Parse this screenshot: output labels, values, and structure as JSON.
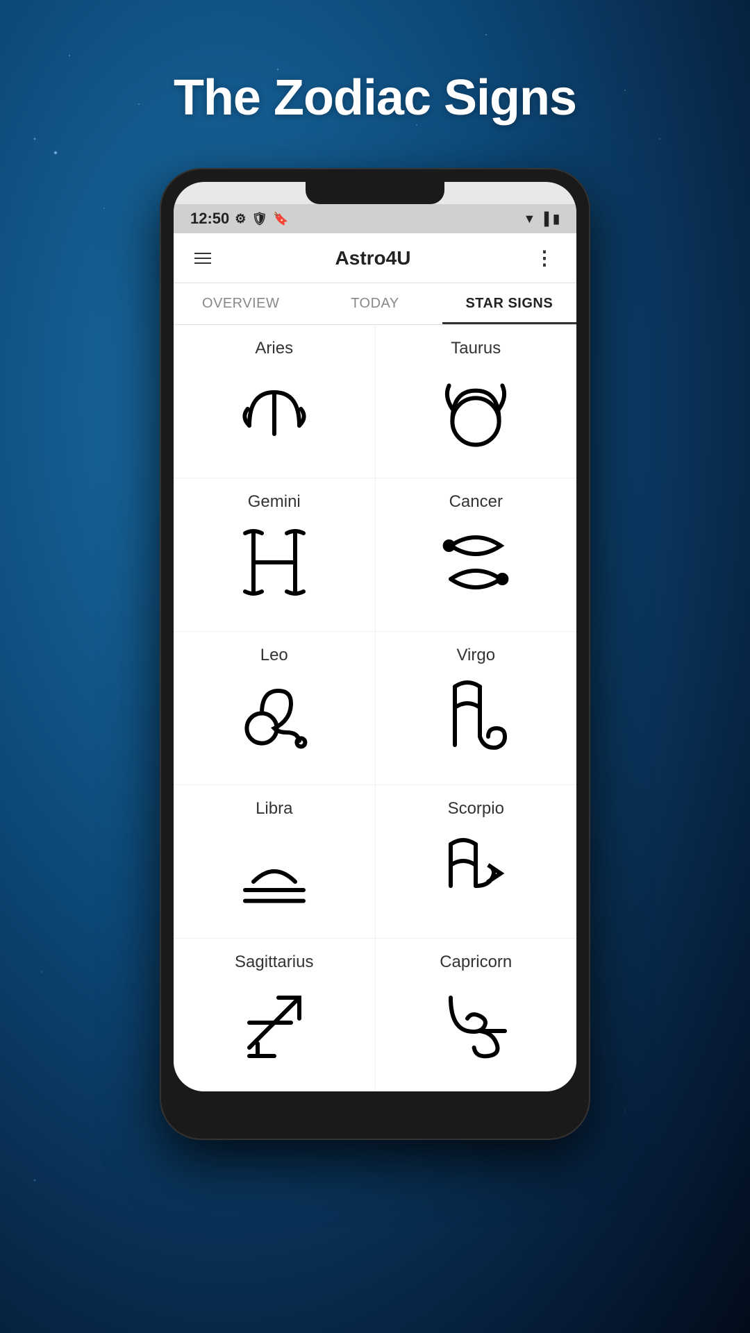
{
  "page": {
    "title": "The Zodiac Signs",
    "background_colors": {
      "top": "#1a6fa8",
      "bottom": "#061e3a"
    }
  },
  "status_bar": {
    "time": "12:50",
    "icons": [
      "gear",
      "shield",
      "bookmark",
      "wifi",
      "signal",
      "battery"
    ]
  },
  "app_bar": {
    "title": "Astro4U",
    "menu_icon": "hamburger",
    "more_icon": "three-dots"
  },
  "tabs": [
    {
      "label": "OVERVIEW",
      "active": false
    },
    {
      "label": "TODAY",
      "active": false
    },
    {
      "label": "STAR SIGNS",
      "active": true
    }
  ],
  "zodiac_signs": [
    {
      "name": "Aries",
      "symbol": "♈"
    },
    {
      "name": "Taurus",
      "symbol": "♉"
    },
    {
      "name": "Gemini",
      "symbol": "♊"
    },
    {
      "name": "Cancer",
      "symbol": "♋"
    },
    {
      "name": "Leo",
      "symbol": "♌"
    },
    {
      "name": "Virgo",
      "symbol": "♍"
    },
    {
      "name": "Libra",
      "symbol": "♎"
    },
    {
      "name": "Scorpio",
      "symbol": "♏"
    },
    {
      "name": "Sagittarius",
      "symbol": "♐"
    },
    {
      "name": "Capricorn",
      "symbol": "♑"
    }
  ]
}
